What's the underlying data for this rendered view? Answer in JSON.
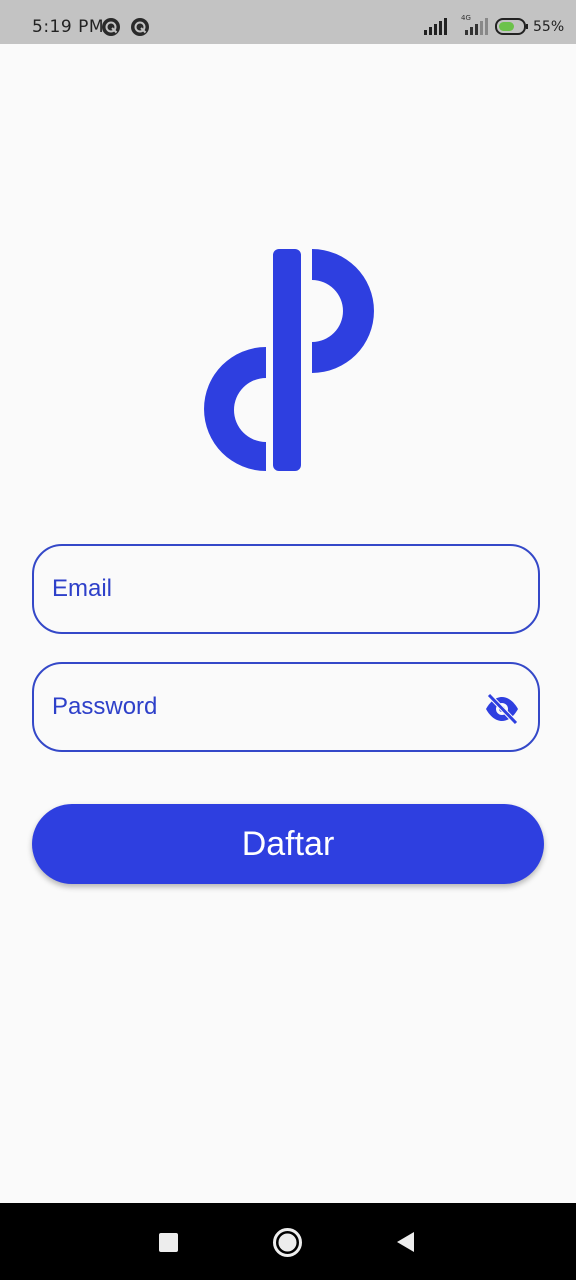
{
  "status_bar": {
    "time": "5:19 PM",
    "notification_icons": [
      "q-notification-icon",
      "q-notification-icon"
    ],
    "signal_label": "4G",
    "battery_percent": 55,
    "battery_text": "55%"
  },
  "login": {
    "email_placeholder": "Email",
    "password_placeholder": "Password",
    "password_toggle_icon": "eye-off-icon",
    "submit_label": "Daftar"
  },
  "colors": {
    "brand_blue": "#2E3FE0",
    "field_border": "#3448C8",
    "background": "#FAFAFA",
    "status_bar": "#C3C3C3",
    "nav_bar": "#000000"
  },
  "nav_bar": {
    "buttons": [
      "recents-icon",
      "home-icon",
      "back-icon"
    ]
  }
}
